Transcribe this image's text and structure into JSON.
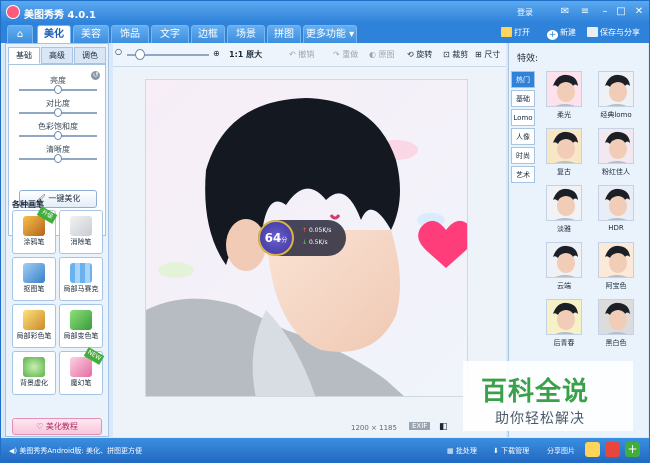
{
  "app": {
    "title": "美图秀秀 4.0.1",
    "login": "登录"
  },
  "tabs": [
    {
      "label": "美化",
      "active": true
    },
    {
      "label": "美容"
    },
    {
      "label": "饰品"
    },
    {
      "label": "文字"
    },
    {
      "label": "边框"
    },
    {
      "label": "场景"
    },
    {
      "label": "拼图"
    },
    {
      "label": "更多功能 ▾"
    }
  ],
  "top_actions": {
    "open": "打开",
    "new": "新建",
    "save": "保存与分享"
  },
  "toolbar": {
    "zoom_label": "1:1 原大",
    "undo": "撤销",
    "redo": "重做",
    "original": "原图",
    "rotate": "旋转",
    "crop": "裁剪",
    "size": "尺寸"
  },
  "left": {
    "subtabs": [
      "基础",
      "高级",
      "调色"
    ],
    "sliders": [
      {
        "label": "亮度",
        "value": 0.5
      },
      {
        "label": "对比度",
        "value": 0.5
      },
      {
        "label": "色彩饱和度",
        "value": 0.5
      },
      {
        "label": "清晰度",
        "value": 0.5
      }
    ],
    "one_key": "一键美化",
    "section": "各种画笔",
    "tools": [
      {
        "label": "涂鸦笔",
        "badge": "升级"
      },
      {
        "label": "消除笔"
      },
      {
        "label": "抠图笔"
      },
      {
        "label": "局部马赛克"
      },
      {
        "label": "局部彩色笔"
      },
      {
        "label": "局部变色笔"
      },
      {
        "label": "背景虚化"
      },
      {
        "label": "魔幻笔",
        "badge": "NEW"
      }
    ],
    "tutorial": "美化教程"
  },
  "photo": {
    "dimensions": "1200 × 1185",
    "score": "64",
    "score_unit": "分",
    "up_speed": "0.05K/s",
    "down_speed": "0.5K/s"
  },
  "effects": {
    "title": "特效:",
    "categories": [
      "热门",
      "基础",
      "Lomo",
      "人像",
      "时尚",
      "艺术"
    ],
    "items": [
      "柔光",
      "经典lomo",
      "复古",
      "粉红佳人",
      "淡雅",
      "HDR",
      "云端",
      "阿宝色",
      "后青春",
      "黑白色"
    ]
  },
  "status": {
    "promo": "美图秀秀Android版: 美化、拼图更方便",
    "batch": "批处理",
    "download": "下载管理",
    "share": "分享图片"
  },
  "watermark": {
    "title": "百科全说",
    "subtitle": "助你轻松解决"
  },
  "colors": {
    "accent": "#2f82da",
    "heart": "#ff3d7a"
  }
}
